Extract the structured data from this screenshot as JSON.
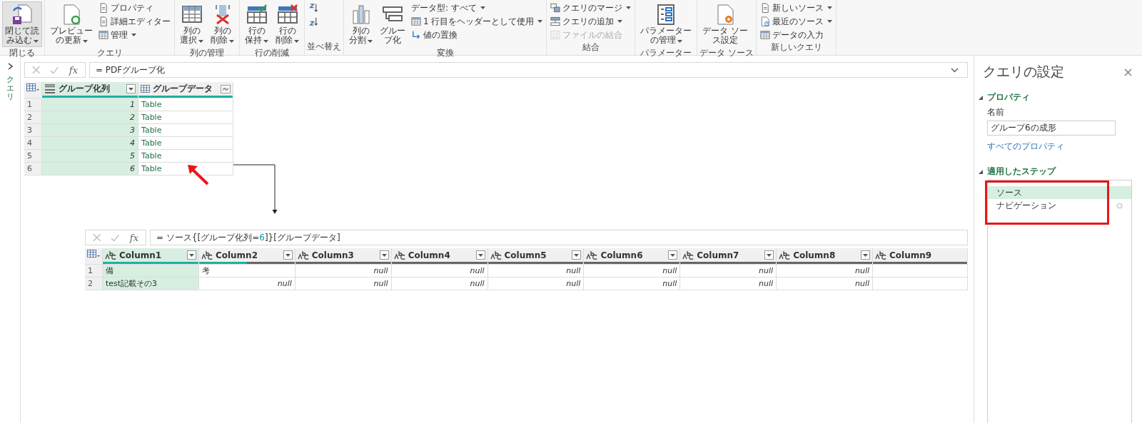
{
  "ribbon": {
    "groups": [
      {
        "label": "閉じる",
        "items": [
          {
            "kind": "large",
            "lines": [
              "閉じて読",
              "み込む"
            ],
            "dropdown": true,
            "selected": true,
            "disabled": false
          }
        ]
      },
      {
        "label": "クエリ",
        "items": [
          {
            "kind": "large",
            "lines": [
              "プレビュー",
              "の更新"
            ],
            "dropdown": true,
            "selected": false,
            "disabled": false
          },
          {
            "kind": "small",
            "label": "プロパティ",
            "dropdown": false,
            "selected": false,
            "disabled": false
          },
          {
            "kind": "small",
            "label": "詳細エディター",
            "dropdown": false,
            "selected": false,
            "disabled": false
          },
          {
            "kind": "small",
            "label": "管理",
            "dropdown": true,
            "selected": false,
            "disabled": false
          }
        ]
      },
      {
        "label": "列の管理",
        "items": [
          {
            "kind": "large",
            "lines": [
              "列の",
              "選択"
            ],
            "dropdown": true,
            "selected": false,
            "disabled": false
          },
          {
            "kind": "large",
            "lines": [
              "列の",
              "削除"
            ],
            "dropdown": true,
            "selected": false,
            "disabled": false
          }
        ]
      },
      {
        "label": "行の削減",
        "items": [
          {
            "kind": "large",
            "lines": [
              "行の",
              "保持"
            ],
            "dropdown": true,
            "selected": false,
            "disabled": false
          },
          {
            "kind": "large",
            "lines": [
              "行の",
              "削除"
            ],
            "dropdown": true,
            "selected": false,
            "disabled": false
          }
        ]
      },
      {
        "label": "並べ替え",
        "items": [
          {
            "kind": "icon",
            "selected": false,
            "disabled": false
          },
          {
            "kind": "icon",
            "selected": false,
            "disabled": false
          }
        ]
      },
      {
        "label": "変換",
        "items": [
          {
            "kind": "large",
            "lines": [
              "列の",
              "分割"
            ],
            "dropdown": true,
            "selected": false,
            "disabled": false
          },
          {
            "kind": "large",
            "lines": [
              "グルー",
              "プ化"
            ],
            "dropdown": false,
            "selected": false,
            "disabled": false
          },
          {
            "kind": "small",
            "label": "データ型: すべて",
            "dropdown": true,
            "selected": false,
            "disabled": false
          },
          {
            "kind": "small",
            "label": "1 行目をヘッダーとして使用",
            "dropdown": true,
            "selected": false,
            "disabled": false
          },
          {
            "kind": "small",
            "label": "値の置換",
            "dropdown": false,
            "selected": false,
            "disabled": false
          }
        ]
      },
      {
        "label": "結合",
        "items": [
          {
            "kind": "small",
            "label": "クエリのマージ",
            "dropdown": true,
            "selected": false,
            "disabled": false
          },
          {
            "kind": "small",
            "label": "クエリの追加",
            "dropdown": true,
            "selected": false,
            "disabled": false
          },
          {
            "kind": "small",
            "label": "ファイルの結合",
            "dropdown": false,
            "selected": false,
            "disabled": true
          }
        ]
      },
      {
        "label": "パラメーター",
        "items": [
          {
            "kind": "large",
            "lines": [
              "パラメーター",
              "の管理"
            ],
            "dropdown": true,
            "selected": false,
            "disabled": false
          }
        ]
      },
      {
        "label": "データ ソース",
        "items": [
          {
            "kind": "large",
            "lines": [
              "データ ソー",
              "ス設定"
            ],
            "dropdown": false,
            "selected": false,
            "disabled": false
          }
        ]
      },
      {
        "label": "新しいクエリ",
        "items": [
          {
            "kind": "small",
            "label": "新しいソース",
            "dropdown": true,
            "selected": false,
            "disabled": false
          },
          {
            "kind": "small",
            "label": "最近のソース",
            "dropdown": true,
            "selected": false,
            "disabled": false
          },
          {
            "kind": "small",
            "label": "データの入力",
            "dropdown": false,
            "selected": false,
            "disabled": false
          }
        ]
      }
    ]
  },
  "queries_pane": {
    "label": "クエリ",
    "expanded": false
  },
  "formula_bar": {
    "function_label": "fx",
    "parts": [
      {
        "kind": "text",
        "text": "= PDFグループ化"
      }
    ]
  },
  "table": {
    "columns": [
      {
        "label": "グループ化列",
        "kind": "any",
        "selected": true,
        "level": 1
      },
      {
        "label": "グループデータ",
        "kind": "table",
        "selected": false,
        "level": 1
      }
    ],
    "rows": [
      {
        "number": "1",
        "cells": [
          "1",
          "Table"
        ]
      },
      {
        "number": "2",
        "cells": [
          "2",
          "Table"
        ]
      },
      {
        "number": "3",
        "cells": [
          "3",
          "Table"
        ]
      },
      {
        "number": "4",
        "cells": [
          "4",
          "Table"
        ]
      },
      {
        "number": "5",
        "cells": [
          "5",
          "Table"
        ]
      },
      {
        "number": "6",
        "cells": [
          "6",
          "Table"
        ]
      }
    ]
  },
  "preview": {
    "formula_bar": {
      "function_label": "fx",
      "parts": [
        {
          "kind": "text",
          "text": "= ソース{[グループ化列="
        },
        {
          "kind": "number",
          "text": "6"
        },
        {
          "kind": "text",
          "text": "]}[グループデータ]"
        }
      ]
    },
    "table": {
      "columns": [
        {
          "label": "Column1",
          "selected": true,
          "level": 1
        },
        {
          "label": "Column2",
          "selected": false,
          "level": 0.5
        },
        {
          "label": "Column3",
          "selected": false,
          "level": 0
        },
        {
          "label": "Column4",
          "selected": false,
          "level": 0
        },
        {
          "label": "Column5",
          "selected": false,
          "level": 0
        },
        {
          "label": "Column6",
          "selected": false,
          "level": 0
        },
        {
          "label": "Column7",
          "selected": false,
          "level": 0
        },
        {
          "label": "Column8",
          "selected": false,
          "level": 0
        },
        {
          "label": "Column9",
          "selected": false,
          "level": 0
        }
      ],
      "rows": [
        {
          "number": "1",
          "cells": [
            {
              "kind": "text",
              "text": "備"
            },
            {
              "kind": "text",
              "text": "考"
            },
            {
              "kind": "null",
              "text": "null"
            },
            {
              "kind": "null",
              "text": "null"
            },
            {
              "kind": "null",
              "text": "null"
            },
            {
              "kind": "null",
              "text": "null"
            },
            {
              "kind": "null",
              "text": "null"
            },
            {
              "kind": "null",
              "text": "null"
            }
          ]
        },
        {
          "number": "2",
          "cells": [
            {
              "kind": "text",
              "text": "test記載その3"
            },
            {
              "kind": "null",
              "text": "null"
            },
            {
              "kind": "null",
              "text": "null"
            },
            {
              "kind": "null",
              "text": "null"
            },
            {
              "kind": "null",
              "text": "null"
            },
            {
              "kind": "null",
              "text": "null"
            },
            {
              "kind": "null",
              "text": "null"
            },
            {
              "kind": "null",
              "text": "null"
            }
          ]
        }
      ]
    }
  },
  "query_settings": {
    "title": "クエリの設定",
    "properties": {
      "heading": "プロパティ",
      "expanded": true,
      "name_label": "名前",
      "name_value": "グループ6の成形",
      "all_properties_link": "すべてのプロパティ"
    },
    "applied_steps": {
      "heading": "適用したステップ",
      "expanded": true,
      "steps": [
        {
          "label": "ソース",
          "selected": true,
          "has_settings": false
        },
        {
          "label": "ナビゲーション",
          "selected": false,
          "has_settings": true
        }
      ]
    }
  }
}
